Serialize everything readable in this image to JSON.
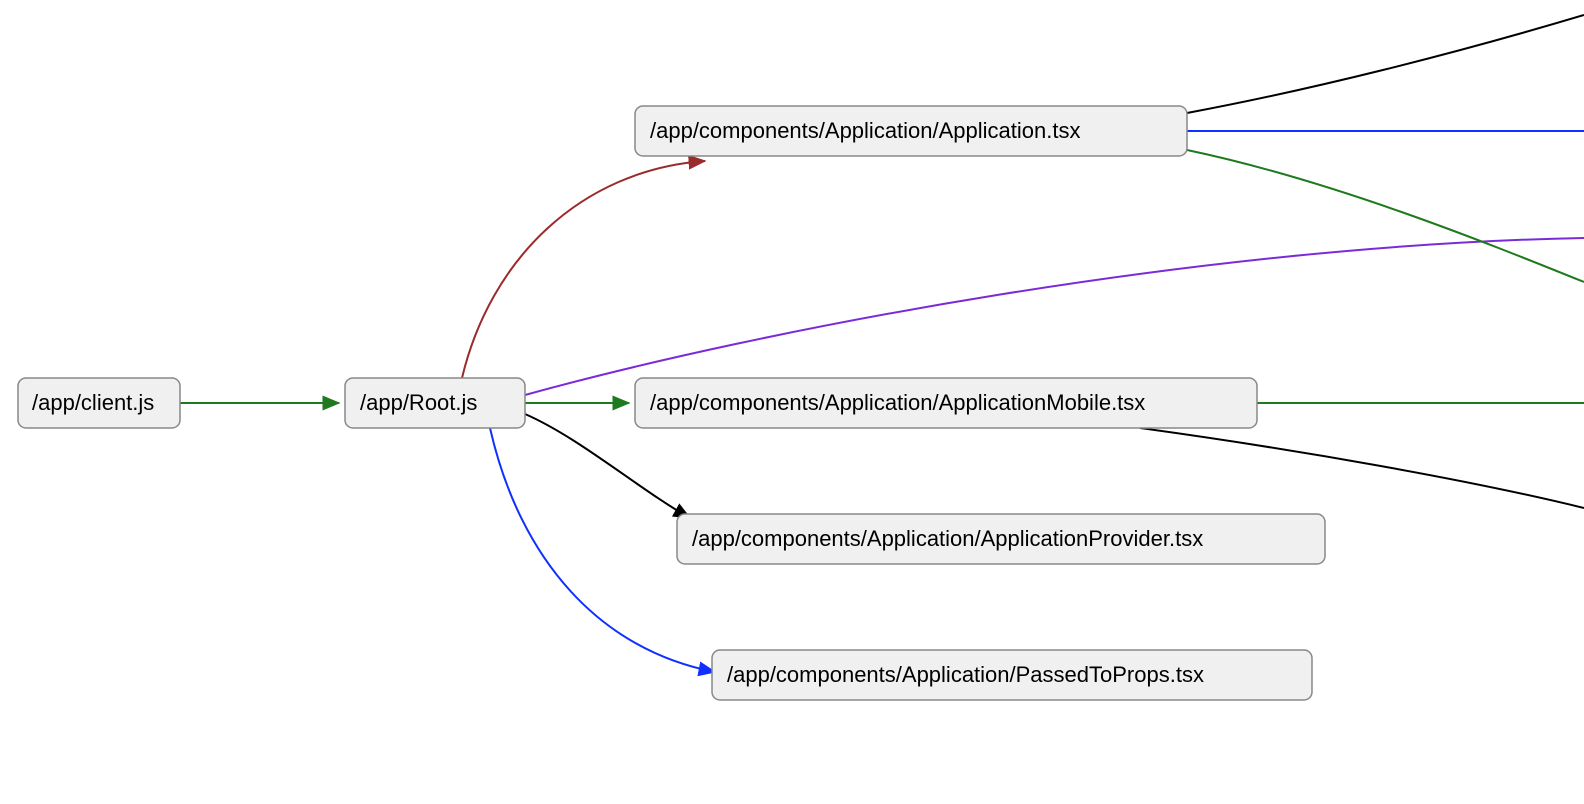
{
  "diagram": {
    "type": "dependency-graph",
    "nodes": {
      "client": {
        "label": "/app/client.js"
      },
      "root": {
        "label": "/app/Root.js"
      },
      "app": {
        "label": "/app/components/Application/Application.tsx"
      },
      "mobile": {
        "label": "/app/components/Application/ApplicationMobile.tsx"
      },
      "provider": {
        "label": "/app/components/Application/ApplicationProvider.tsx"
      },
      "passed": {
        "label": "/app/components/Application/PassedToProps.tsx"
      }
    },
    "edges": [
      {
        "from": "client",
        "to": "root",
        "color": "#1e7a1e",
        "arrow": true
      },
      {
        "from": "root",
        "to": "app",
        "color": "#9a2b2b",
        "arrow": true
      },
      {
        "from": "root",
        "to": "mobile",
        "color": "#1e7a1e",
        "arrow": true
      },
      {
        "from": "root",
        "to": "provider",
        "color": "#000000",
        "arrow": true
      },
      {
        "from": "root",
        "to": "passed",
        "color": "#1030ff",
        "arrow": true
      },
      {
        "from": "root",
        "to": "offscreen-purple",
        "color": "#7a2bd8",
        "arrow": false
      },
      {
        "from": "app",
        "to": "offscreen-black",
        "color": "#000000",
        "arrow": false
      },
      {
        "from": "app",
        "to": "offscreen-blue",
        "color": "#1030ff",
        "arrow": false
      },
      {
        "from": "app",
        "to": "offscreen-green",
        "color": "#1e7a1e",
        "arrow": false
      },
      {
        "from": "mobile",
        "to": "offscreen-green2",
        "color": "#1e7a1e",
        "arrow": false
      },
      {
        "from": "mobile",
        "to": "offscreen-black2",
        "color": "#000000",
        "arrow": false
      }
    ],
    "colors": {
      "green": "#1e7a1e",
      "red": "#9a2b2b",
      "black": "#000000",
      "blue": "#1030ff",
      "purple": "#7a2bd8"
    }
  }
}
